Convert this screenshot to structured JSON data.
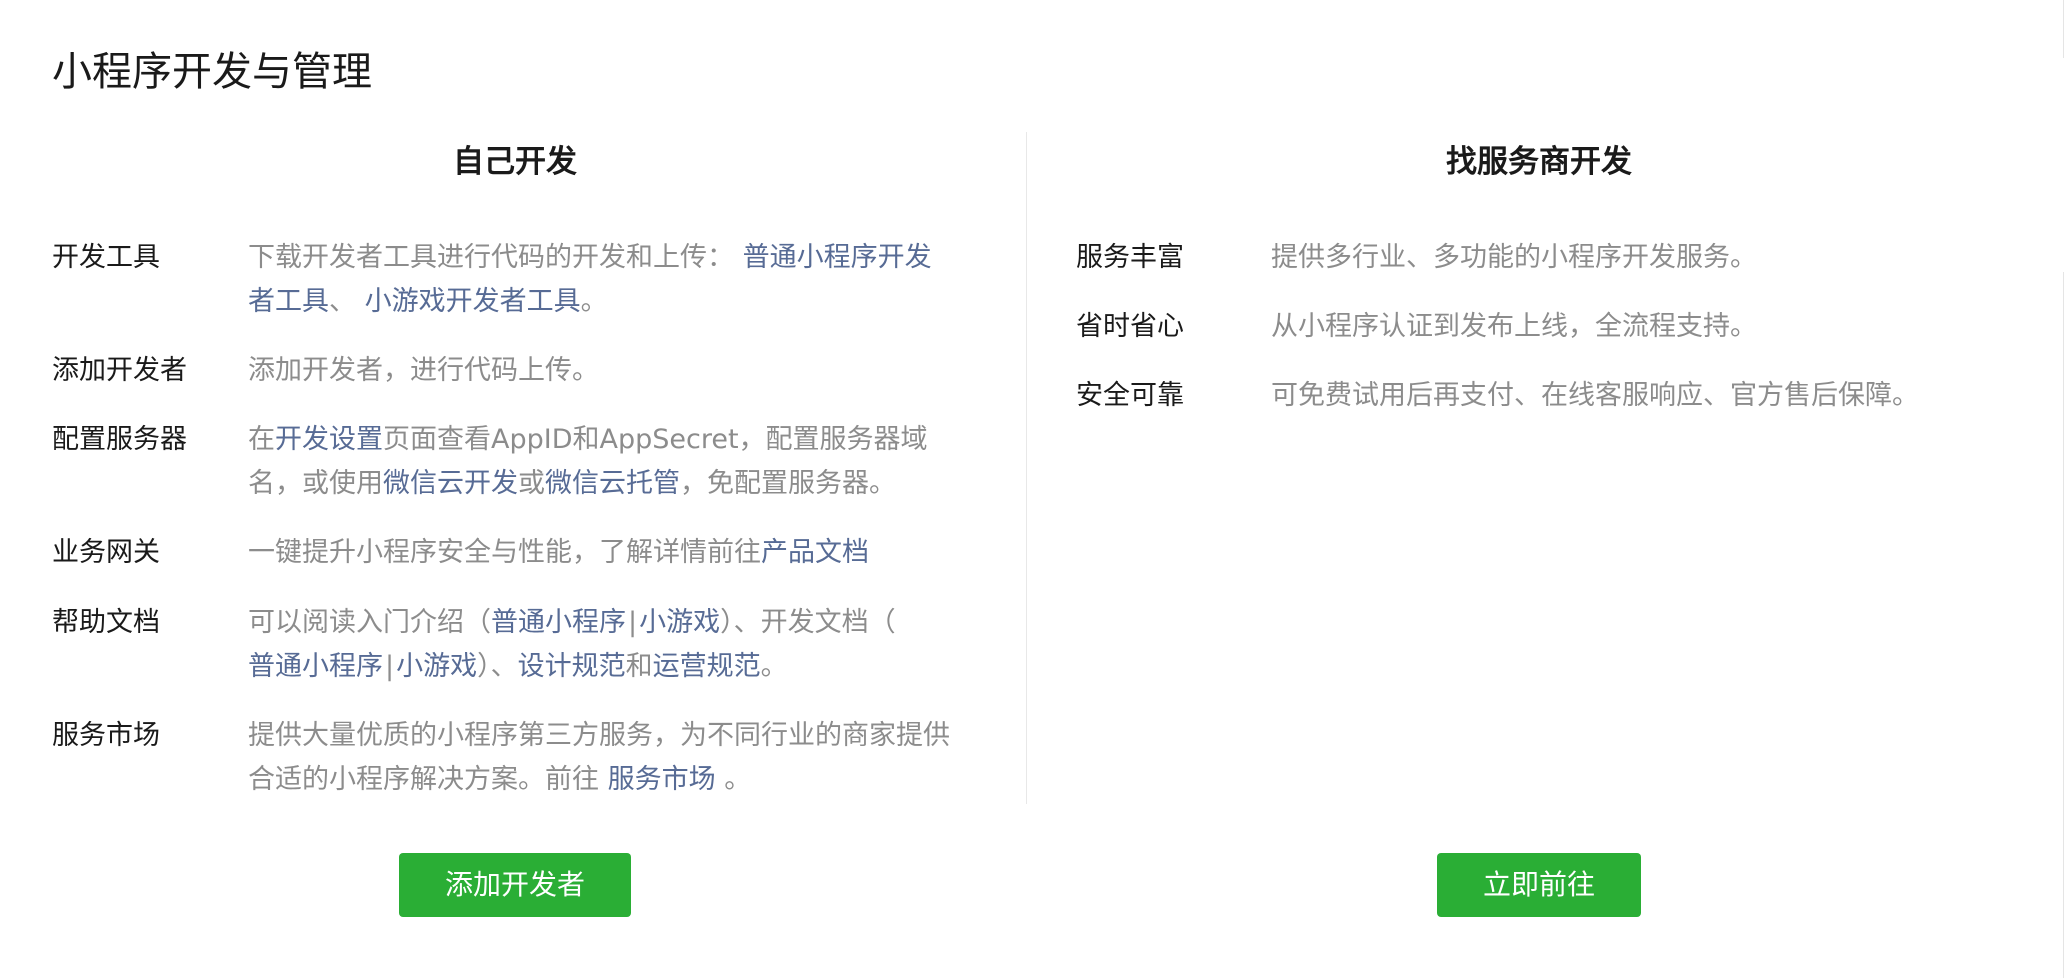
{
  "page": {
    "title": "小程序开发与管理"
  },
  "self_dev": {
    "title": "自己开发",
    "tools": {
      "label": "开发工具",
      "text_before": "下载开发者工具进行代码的开发和上传：",
      "link_normal_tools_1": "普通小程序开发",
      "link_normal_tools_2": "者工具",
      "sep": "、",
      "link_game_tools": "小游戏开发者工具",
      "end": "。"
    },
    "add_dev": {
      "label": "添加开发者",
      "text": "添加开发者，进行代码上传。"
    },
    "server": {
      "label": "配置服务器",
      "pre": "在",
      "link_dev_settings": "开发设置",
      "mid1": "页面查看AppID和AppSecret，配置服务器域",
      "mid2": "名，或使用",
      "link_cloud_dev": "微信云开发",
      "or": "或",
      "link_cloud_host": "微信云托管",
      "end": "，免配置服务器。"
    },
    "gateway": {
      "label": "业务网关",
      "text": "一键提升小程序安全与性能，了解详情前往",
      "link_docs": "产品文档"
    },
    "help": {
      "label": "帮助文档",
      "intro": "可以阅读入门介绍（",
      "link_intro_normal": "普通小程序",
      "pipe": "|",
      "link_intro_game": "小游戏",
      "close1": "）、开发文档（",
      "link_dev_normal": "普通小程序",
      "link_dev_game": "小游戏",
      "close2": "）、",
      "link_design": "设计规范",
      "and": "和",
      "link_ops": "运营规范",
      "end": "。"
    },
    "market": {
      "label": "服务市场",
      "text1": "提供大量优质的小程序第三方服务，为不同行业的商家提供",
      "text2": "合适的小程序解决方案。前往",
      "link_market": "服务市场",
      "end": "。"
    },
    "button": "添加开发者"
  },
  "provider_dev": {
    "title": "找服务商开发",
    "rich": {
      "label": "服务丰富",
      "text": "提供多行业、多功能的小程序开发服务。"
    },
    "save": {
      "label": "省时省心",
      "text": "从小程序认证到发布上线，全流程支持。"
    },
    "safe": {
      "label": "安全可靠",
      "text": "可免费试用后再支付、在线客服响应、官方售后保障。"
    },
    "button": "立即前往"
  }
}
